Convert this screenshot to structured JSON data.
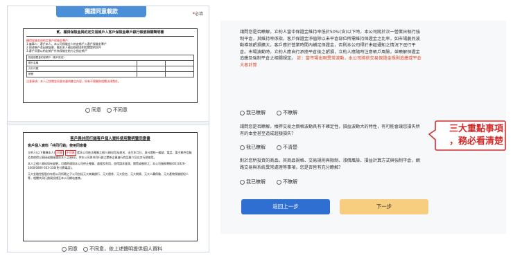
{
  "left": {
    "consent_tab": "獨請同意載款",
    "required": "必填",
    "required_mark": "*",
    "doc1": {
      "title": "貳、權得保險金與約定交易帳戶入客戶保險金專戶銀行帳號相關聲明書",
      "line1": "權得保險金與約定客戶保險金專戶：",
      "line2": "1.當事人：客戶本人，本公司保險金人約定帳戶入客戶保險金專戶",
      "line3": "2.前述帳戶若因故變更，應由本人親自辦理並附相關證明文件",
      "line4": "3.客戶同意以約定帳戶作為保險金給付之指定帳戶",
      "table_head": "指定保險金約定帳戶（客戶姓名）",
      "row1": "銀行名稱",
      "row2": "分行代號",
      "row3": "帳號",
      "notice": "注意事項：本人已詳閱並同意本聲明書之內容，如有不實願負相關法律責任。"
    },
    "doc1_agree": "同意",
    "doc1_disagree": "不同意",
    "doc2": {
      "title": "客戶與共同行銷客戶個人資料使用聲明暨同意書",
      "subtitle": "客戶個人資料「共同行銷」使用同意書",
      "p1a": "立約人(以下簡稱本人)",
      "p1b": "同意",
      "p1c": "不同意",
      "p1d": "就本公司依法蒐集之個人資料(包括姓名、出生年月日、身分證統一編號、電話、電子郵件信箱及其他得以直接或間接識別本人之資料)，供本公司與共同行銷之關係企業進行商品推介及交叉行銷使用。",
      "p2": "本人之個人資料如有變更，可隨時通知本公司停止蒐集、處理及利用，並得請求查詢、閱覽或刪除之；本公司服務專線(02)3326-1000/0800-333-338(免付費電話)。",
      "p3": "元大金融控股股份有限公司所屬之子公司包括元大商業銀行、元大證券、元大投信、元大期貨、元大人壽保險、元大產物保險經紀人等，相關共同行銷資訊請至本公司網站查詢。"
    },
    "doc2_agree": "同意",
    "doc2_disagree": "不同意，依上述聲明提供個人資料"
  },
  "right": {
    "q1_text": "請問您是否瞭解，立約人當中保證金維持率低於50%(含)以下時，本公司將於次一營業日執行強制平倉，其維持率係指，客戶保證金淨值除以未平倉部位所需維持保證金之比率，如市場劇烈波動導致虧損擴大，客戶應於營業時間內補足保證金，否則本公司得於未經通知之情況下逕行平倉。市場波動時，立約人應自行承擔平倉後之虧損，立約人應隨時注意帳戶風險，並瞭解保證金追繳及強制平倉之相關規定。",
    "q1_red": "註：當市場出現異常波動，本公司將依交易保證金規則追繳或平倉大者計算",
    "q1_yes": "我已瞭解",
    "q1_no": "不瞭解",
    "q2_text": "請問您是否瞭解，槓桿交易之價格波動具有不確定性，損益波動大的特性，有可能會讓您損失所有的本金甚至造成超額損失？",
    "q2_yes": "我已瞭解",
    "q2_no": "不清楚",
    "q3_text": "對於您所投資的商品，其商品規格、交易規則與限制、漲價風險、損益計算方式與強制平倉，網路交易與系統異常處理等事項，您是否皆有充分瞭解？",
    "q3_yes": "我已瞭解",
    "q3_no": "不瞭解",
    "back_button": "返回上一步",
    "next_button": "下一步"
  },
  "callout": {
    "line1": "三大重點事項",
    "line2": "，務必看清楚",
    "color": "#d42b2b"
  }
}
